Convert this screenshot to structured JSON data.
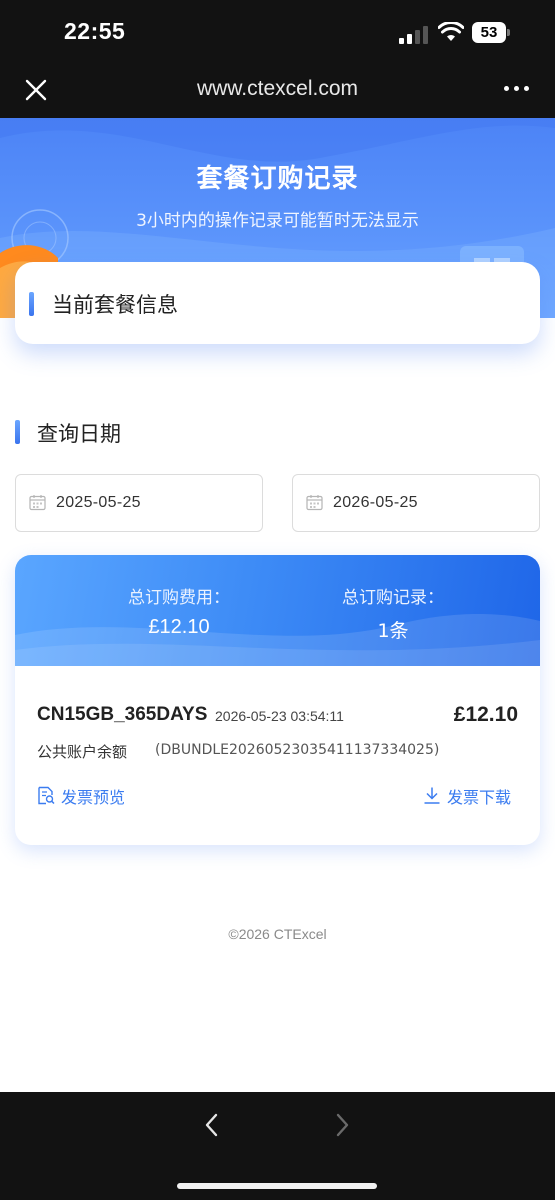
{
  "status_bar": {
    "time": "22:55",
    "battery": "53"
  },
  "browser": {
    "url": "www.ctexcel.com",
    "close_icon": "close-icon",
    "more_icon": "more-dots-icon"
  },
  "hero": {
    "title": "套餐订购记录",
    "subtitle": "3小时内的操作记录可能暂时无法显示"
  },
  "package": {
    "title": "当前套餐信息"
  },
  "query": {
    "title": "查询日期",
    "start_date": "2025-05-25",
    "end_date": "2026-05-25",
    "date_icon": "calendar-icon"
  },
  "summary": {
    "total_fee_label": "总订购费用：",
    "total_fee_value": "£12.10",
    "total_records_label": "总订购记录：",
    "total_records_value": "1条"
  },
  "orders": [
    {
      "name": "CN15GB_365DAYS",
      "time": "2026-05-23 03:54:11",
      "price": "£12.10",
      "account": "公共账户余额",
      "order_id": "(DBUNDLE20260523035411137334025)",
      "preview_label": "发票预览",
      "download_label": "发票下载"
    }
  ],
  "footer": {
    "copyright": "©2026 CTExcel"
  },
  "colors": {
    "accent": "#3b7cf0",
    "hero_blue": "#5a93fb",
    "dark_bar": "#121212"
  }
}
